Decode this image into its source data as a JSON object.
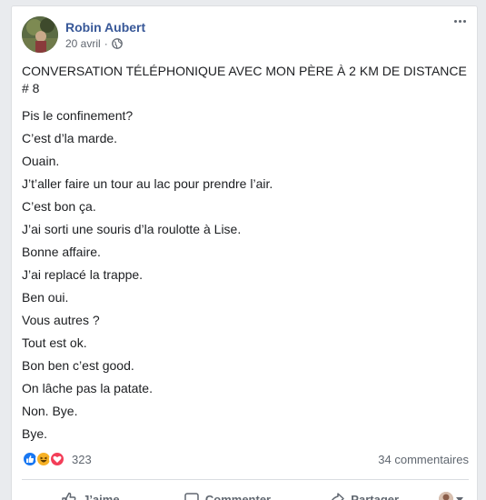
{
  "post": {
    "author": "Robin Aubert",
    "date": "20 avril",
    "separator": "·",
    "privacy_icon": "globe-icon",
    "title": "CONVERSATION TÉLÉPHONIQUE AVEC MON PÈRE À 2 KM DE DISTANCE # 8",
    "lines": [
      "Pis le confinement?",
      "C’est d’la marde.",
      "Ouain.",
      "J’t’aller faire un tour au lac pour prendre l’air.",
      "C’est bon ça.",
      "J’ai sorti une souris d’la roulotte à Lise.",
      "Bonne affaire.",
      "J’ai replacé la trappe.",
      "Ben oui.",
      "Vous autres ?",
      "Tout est ok.",
      "Bon ben c’est good.",
      "On lâche pas la patate.",
      "Non. Bye.",
      "Bye."
    ]
  },
  "reactions": {
    "icons": [
      "like-icon",
      "haha-icon",
      "love-icon"
    ],
    "count": "323",
    "comments": "34 commentaires"
  },
  "actions": {
    "like": "J’aime",
    "comment": "Commenter",
    "share": "Partager"
  },
  "colors": {
    "author": "#385898",
    "like": "#1877f2",
    "haha": "#f7b125",
    "love": "#f33e58"
  }
}
